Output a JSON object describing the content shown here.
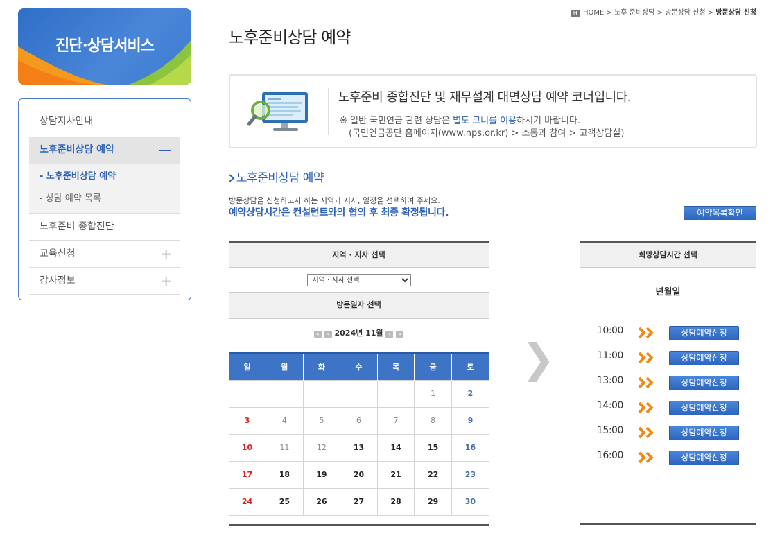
{
  "sidebar": {
    "banner_title": "진단·상담서비스",
    "items": [
      {
        "label": "상담지사안내"
      },
      {
        "label": "노후준비상담 예약",
        "sign": "—"
      },
      {
        "label": "노후준비 종합진단"
      },
      {
        "label": "교육신청",
        "sign": "+"
      },
      {
        "label": "강사정보",
        "sign": "+"
      }
    ],
    "sub_items": [
      {
        "label": "- 노후준비상담 예약"
      },
      {
        "label": "- 상담 예약 목록"
      }
    ]
  },
  "breadcrumb": {
    "home_icon": "H",
    "path": "HOME > 노후 준비상담 > 방문상담 신청 > ",
    "current": "방문상담 신청"
  },
  "page_title": "노후준비상담 예약",
  "info_box": {
    "heading": "노후준비 종합진단 및 재무설계 대면상담 예약 코너입니다.",
    "note_prefix": "※  일반 국민연금 관련 상담은 ",
    "note_highlight": "별도 코너를 이용",
    "note_suffix": "하시기 바랍니다.",
    "note_line2": "(국민연금공단 홈페이지(www.nps.or.kr) > 소통과 참여 > 고객상담실)"
  },
  "section": {
    "title": "노후준비상담 예약",
    "description": "방문상담을 신청하고자 하는 지역과 지사, 일정을 선택하여 주세요.",
    "emphasis": "예약상담시간은 컨설턴트와의 협의 후 최종 확정됩니다.",
    "list_button": "예약목록확인"
  },
  "reservation": {
    "region_header": "지역 · 지사 선택",
    "region_select_value": "지역 · 지사 선택",
    "date_header": "방문일자 선택",
    "month_label": "2024년 11월",
    "nav": {
      "prev_year": "«",
      "prev_month": "‹",
      "next_month": "›",
      "next_year": "»"
    },
    "weekdays": [
      "일",
      "월",
      "화",
      "수",
      "목",
      "금",
      "토"
    ],
    "weeks": [
      [
        "",
        "",
        "",
        "",
        "",
        "1",
        "2"
      ],
      [
        "3",
        "4",
        "5",
        "6",
        "7",
        "8",
        "9"
      ],
      [
        "10",
        "11",
        "12",
        "13",
        "14",
        "15",
        "16"
      ],
      [
        "17",
        "18",
        "19",
        "20",
        "21",
        "22",
        "23"
      ],
      [
        "24",
        "25",
        "26",
        "27",
        "28",
        "29",
        "30"
      ]
    ],
    "past_days": [
      "1",
      "2",
      "4",
      "5",
      "6",
      "7",
      "8",
      "9",
      "11",
      "12"
    ]
  },
  "time_panel": {
    "header": "희망상담시간 선택",
    "date_label": "년월일",
    "slots": [
      {
        "time": "10:00",
        "button": "상담예약신청"
      },
      {
        "time": "11:00",
        "button": "상담예약신청"
      },
      {
        "time": "13:00",
        "button": "상담예약신청"
      },
      {
        "time": "14:00",
        "button": "상담예약신청"
      },
      {
        "time": "15:00",
        "button": "상담예약신청"
      },
      {
        "time": "16:00",
        "button": "상담예약신청"
      }
    ]
  },
  "colors": {
    "accent_blue": "#2f62b8",
    "header_blue": "#3e74c5",
    "sunday_red": "#dd2222",
    "chevron_orange": "#f08a12"
  }
}
